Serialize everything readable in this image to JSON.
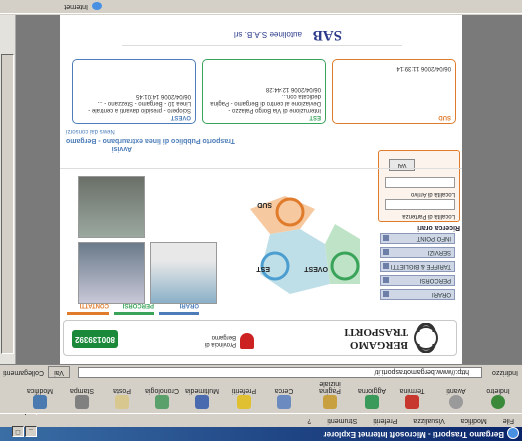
{
  "window": {
    "title": "Bergamo Trasporti - Microsoft Internet Explorer",
    "status_right": "Internet"
  },
  "menu": [
    "File",
    "Modifica",
    "Visualizza",
    "Preferiti",
    "Strumenti",
    "?"
  ],
  "toolbar": [
    "Indietro",
    "Avanti",
    "Termina",
    "Aggiorna",
    "Pagina iniziale",
    "Cerca",
    "Preferiti",
    "Multimedia",
    "Cronologia",
    "Posta",
    "Stampa",
    "Modifica"
  ],
  "address": {
    "label": "Indirizzo",
    "url": "http://www.bergamotrasporti.it/",
    "go": "Vai",
    "links": "Collegamenti"
  },
  "header": {
    "logo_top": "BERGAMO",
    "logo_bottom": "TRASPORTI",
    "provincia_label": "Provincia di Bergamo",
    "phone": "800139392"
  },
  "tabs": [
    {
      "label": "ORARI",
      "color": "#4d7db8"
    },
    {
      "label": "PERCORSI",
      "color": "#3aa35a"
    },
    {
      "label": "CONTATTI",
      "color": "#e07b2c"
    }
  ],
  "nav": [
    "ORARI",
    "PERCORSI",
    "TARIFFE & BIGLIETTI",
    "SERVIZI",
    "INFO POINT"
  ],
  "search": {
    "title": "Ricerca orari",
    "from_label": "Località di Partenza",
    "to_label": "Località di Arrivo",
    "go": "VAI"
  },
  "map": {
    "zones": [
      "OVEST",
      "EST",
      "SUD"
    ]
  },
  "news_header": {
    "label": "Avvisi",
    "title": "Trasporto Pubblico di linea extraurbano - Bergamo",
    "sub": "News dai consorzi"
  },
  "news": [
    {
      "zone": "OVEST",
      "color": "#4d7db8",
      "date": "06/04/2006 14:01:45",
      "text": "Sciopero - presidio davanti a centrale - Linea 10 - Bergamo - Stezzano - ..."
    },
    {
      "zone": "EST",
      "color": "#3aa35a",
      "date": "06/04/2006 12:44:28",
      "text": "Interruzione di Via Borgo Palazzo - Deviazione al centro di Bergamo - Pagina dedicata con..."
    },
    {
      "zone": "SUD",
      "color": "#e07b2c",
      "date": "06/04/2006 11:39:14",
      "text": ""
    }
  ],
  "banner": {
    "brand": "SAB",
    "text": "autolinee S.A.B. srl"
  }
}
